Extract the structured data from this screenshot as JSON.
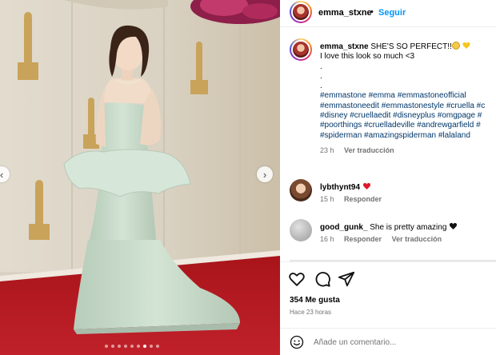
{
  "post": {
    "author": "emma_stxne",
    "follow_label": "Seguir",
    "separator": "•",
    "caption": {
      "username": "emma_stxne",
      "headline": "SHE'S SO PERFECT!!",
      "emojis": [
        "face-holding-back-tears",
        "yellow-heart"
      ],
      "lines": [
        "I love this look so much <3",
        ".",
        ".",
        "."
      ],
      "hashtag_lines": [
        "#emmastone #emma #emmastoneofficial",
        "#emmastoneedit #emmastonestyle #cruella #c",
        "#disney #cruellaedit #disneyplus #omgpage #",
        "#poorthings #cruelladeville #andrewgarfield #",
        "#spiderman #amazingspiderman #lalaland"
      ],
      "time": "23 h",
      "translate": "Ver traducción"
    },
    "comments": [
      {
        "username": "lybthynt94",
        "text": "",
        "emoji": "red-heart",
        "time": "15 h",
        "reply": "Responder",
        "translate": ""
      },
      {
        "username": "good_gunk_",
        "text": "She is pretty amazing",
        "emoji": "black-heart",
        "time": "16 h",
        "reply": "Responder",
        "translate": "Ver traducción"
      }
    ],
    "likes": "354 Me gusta",
    "posted": "Hace 23 horas",
    "comment_placeholder": "Añade un comentario...",
    "carousel": {
      "count": 9,
      "active_index": 6,
      "prev_icon": "chevron-left-icon",
      "next_icon": "chevron-right-icon"
    },
    "icons": [
      "heart-icon",
      "comment-icon",
      "share-icon",
      "emoji-icon"
    ],
    "colors": {
      "accent": "#0095f6",
      "hashtag": "#00376b",
      "muted": "#737373",
      "carpet": "#b3151b",
      "dress": "#c9dccb"
    }
  }
}
